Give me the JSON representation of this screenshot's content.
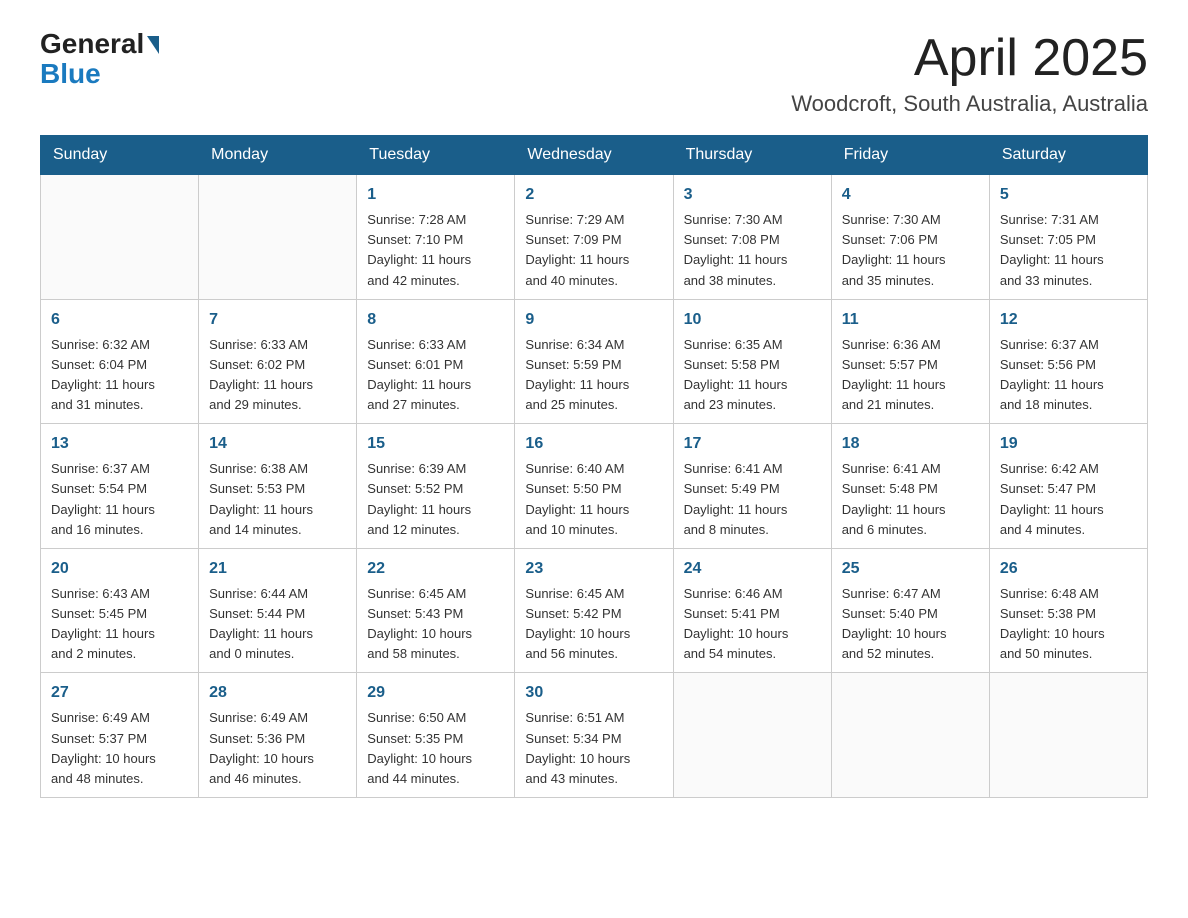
{
  "header": {
    "logo_general": "General",
    "logo_blue": "Blue",
    "month_title": "April 2025",
    "location": "Woodcroft, South Australia, Australia"
  },
  "days_of_week": [
    "Sunday",
    "Monday",
    "Tuesday",
    "Wednesday",
    "Thursday",
    "Friday",
    "Saturday"
  ],
  "weeks": [
    [
      {
        "day": "",
        "info": ""
      },
      {
        "day": "",
        "info": ""
      },
      {
        "day": "1",
        "info": "Sunrise: 7:28 AM\nSunset: 7:10 PM\nDaylight: 11 hours\nand 42 minutes."
      },
      {
        "day": "2",
        "info": "Sunrise: 7:29 AM\nSunset: 7:09 PM\nDaylight: 11 hours\nand 40 minutes."
      },
      {
        "day": "3",
        "info": "Sunrise: 7:30 AM\nSunset: 7:08 PM\nDaylight: 11 hours\nand 38 minutes."
      },
      {
        "day": "4",
        "info": "Sunrise: 7:30 AM\nSunset: 7:06 PM\nDaylight: 11 hours\nand 35 minutes."
      },
      {
        "day": "5",
        "info": "Sunrise: 7:31 AM\nSunset: 7:05 PM\nDaylight: 11 hours\nand 33 minutes."
      }
    ],
    [
      {
        "day": "6",
        "info": "Sunrise: 6:32 AM\nSunset: 6:04 PM\nDaylight: 11 hours\nand 31 minutes."
      },
      {
        "day": "7",
        "info": "Sunrise: 6:33 AM\nSunset: 6:02 PM\nDaylight: 11 hours\nand 29 minutes."
      },
      {
        "day": "8",
        "info": "Sunrise: 6:33 AM\nSunset: 6:01 PM\nDaylight: 11 hours\nand 27 minutes."
      },
      {
        "day": "9",
        "info": "Sunrise: 6:34 AM\nSunset: 5:59 PM\nDaylight: 11 hours\nand 25 minutes."
      },
      {
        "day": "10",
        "info": "Sunrise: 6:35 AM\nSunset: 5:58 PM\nDaylight: 11 hours\nand 23 minutes."
      },
      {
        "day": "11",
        "info": "Sunrise: 6:36 AM\nSunset: 5:57 PM\nDaylight: 11 hours\nand 21 minutes."
      },
      {
        "day": "12",
        "info": "Sunrise: 6:37 AM\nSunset: 5:56 PM\nDaylight: 11 hours\nand 18 minutes."
      }
    ],
    [
      {
        "day": "13",
        "info": "Sunrise: 6:37 AM\nSunset: 5:54 PM\nDaylight: 11 hours\nand 16 minutes."
      },
      {
        "day": "14",
        "info": "Sunrise: 6:38 AM\nSunset: 5:53 PM\nDaylight: 11 hours\nand 14 minutes."
      },
      {
        "day": "15",
        "info": "Sunrise: 6:39 AM\nSunset: 5:52 PM\nDaylight: 11 hours\nand 12 minutes."
      },
      {
        "day": "16",
        "info": "Sunrise: 6:40 AM\nSunset: 5:50 PM\nDaylight: 11 hours\nand 10 minutes."
      },
      {
        "day": "17",
        "info": "Sunrise: 6:41 AM\nSunset: 5:49 PM\nDaylight: 11 hours\nand 8 minutes."
      },
      {
        "day": "18",
        "info": "Sunrise: 6:41 AM\nSunset: 5:48 PM\nDaylight: 11 hours\nand 6 minutes."
      },
      {
        "day": "19",
        "info": "Sunrise: 6:42 AM\nSunset: 5:47 PM\nDaylight: 11 hours\nand 4 minutes."
      }
    ],
    [
      {
        "day": "20",
        "info": "Sunrise: 6:43 AM\nSunset: 5:45 PM\nDaylight: 11 hours\nand 2 minutes."
      },
      {
        "day": "21",
        "info": "Sunrise: 6:44 AM\nSunset: 5:44 PM\nDaylight: 11 hours\nand 0 minutes."
      },
      {
        "day": "22",
        "info": "Sunrise: 6:45 AM\nSunset: 5:43 PM\nDaylight: 10 hours\nand 58 minutes."
      },
      {
        "day": "23",
        "info": "Sunrise: 6:45 AM\nSunset: 5:42 PM\nDaylight: 10 hours\nand 56 minutes."
      },
      {
        "day": "24",
        "info": "Sunrise: 6:46 AM\nSunset: 5:41 PM\nDaylight: 10 hours\nand 54 minutes."
      },
      {
        "day": "25",
        "info": "Sunrise: 6:47 AM\nSunset: 5:40 PM\nDaylight: 10 hours\nand 52 minutes."
      },
      {
        "day": "26",
        "info": "Sunrise: 6:48 AM\nSunset: 5:38 PM\nDaylight: 10 hours\nand 50 minutes."
      }
    ],
    [
      {
        "day": "27",
        "info": "Sunrise: 6:49 AM\nSunset: 5:37 PM\nDaylight: 10 hours\nand 48 minutes."
      },
      {
        "day": "28",
        "info": "Sunrise: 6:49 AM\nSunset: 5:36 PM\nDaylight: 10 hours\nand 46 minutes."
      },
      {
        "day": "29",
        "info": "Sunrise: 6:50 AM\nSunset: 5:35 PM\nDaylight: 10 hours\nand 44 minutes."
      },
      {
        "day": "30",
        "info": "Sunrise: 6:51 AM\nSunset: 5:34 PM\nDaylight: 10 hours\nand 43 minutes."
      },
      {
        "day": "",
        "info": ""
      },
      {
        "day": "",
        "info": ""
      },
      {
        "day": "",
        "info": ""
      }
    ]
  ]
}
